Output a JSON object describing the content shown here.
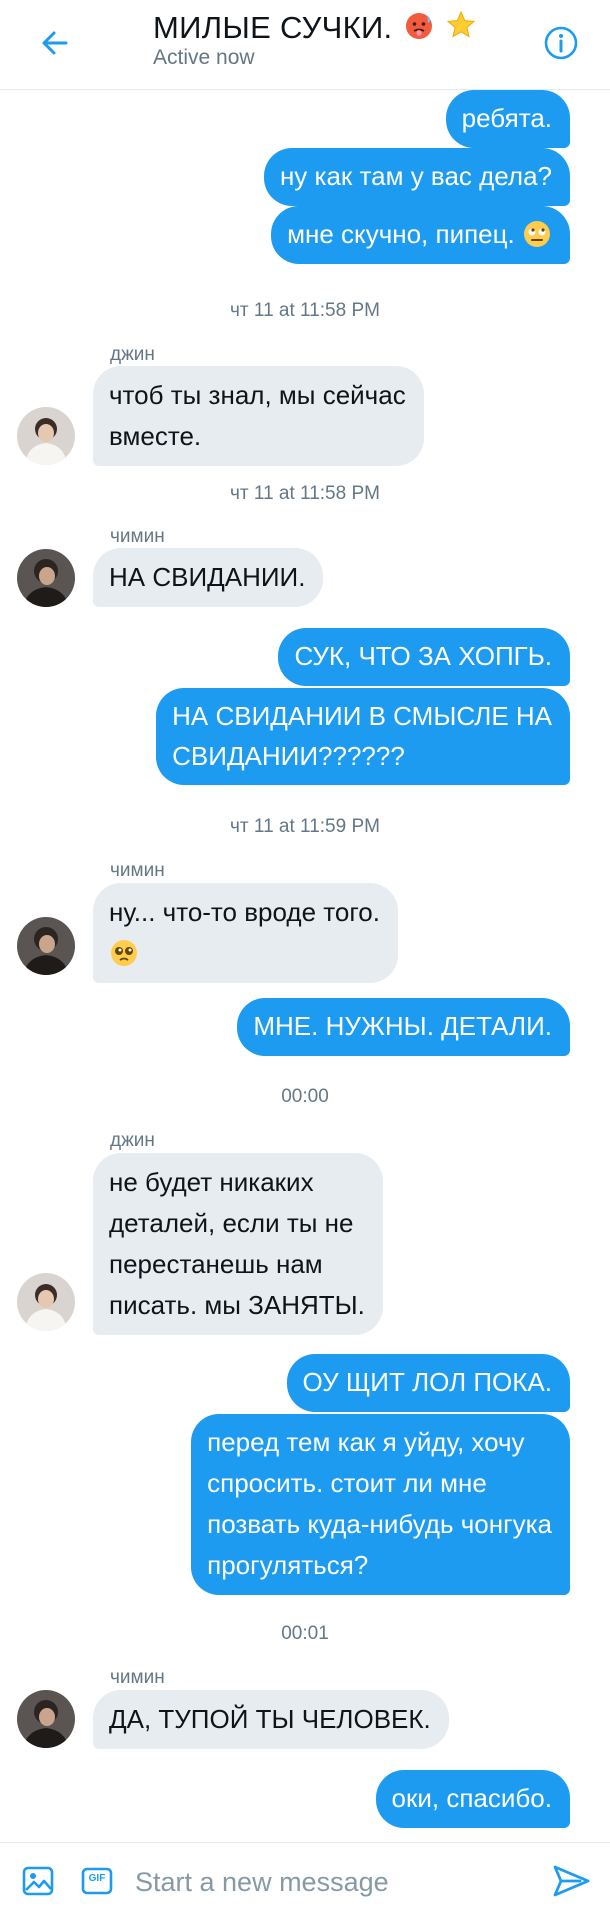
{
  "header": {
    "title": "МИЛЫЕ СУЧКИ.",
    "title_emojis": [
      "hot-face-emoji",
      "star-emoji"
    ],
    "status": "Active now",
    "back_icon": "arrow-left-icon",
    "info_icon": "info-icon"
  },
  "colors": {
    "accent": "#1d9bf0",
    "incoming_bubble": "#e7ecf0",
    "muted_text": "#657786"
  },
  "messages": {
    "m1": "ребята.",
    "m2": "ну как там у вас дела?",
    "m3": "мне скучно, пипец.",
    "m3_emoji": "face-with-rolling-eyes-emoji",
    "ts1": "чт 11 at 11:58 PM",
    "s1": "джин",
    "m4_l1": "чтоб ты знал, мы сейчас",
    "m4_l2": "вместе.",
    "ts2": "чт 11 at 11:58 PM",
    "s2": "чимин",
    "m5": "НА СВИДАНИИ.",
    "m6": "СУК, ЧТО ЗА ХОПГЬ.",
    "m7_l1": "НА СВИДАНИИ В СМЫСЛЕ НА",
    "m7_l2": "СВИДАНИИ??????",
    "ts3": "чт 11 at 11:59 PM",
    "s3": "чимин",
    "m8": "ну... что-то вроде того.",
    "m8_emoji": "pleading-face-emoji",
    "m9": "МНЕ. НУЖНЫ. ДЕТАЛИ.",
    "ts4": "00:00",
    "s4": "джин",
    "m10_l1": "не будет никаких",
    "m10_l2": "деталей, если ты не",
    "m10_l3": "перестанешь нам",
    "m10_l4": "писать. мы ЗАНЯТЫ.",
    "m11": "ОУ ЩИТ ЛОЛ ПОКА.",
    "m12_l1": "перед тем как я уйду, хочу",
    "m12_l2": "спросить. стоит ли мне",
    "m12_l3": "позвать куда-нибудь чонгука",
    "m12_l4": "прогуляться?",
    "ts5": "00:01",
    "s5": "чимин",
    "m13": "ДА, ТУПОЙ ТЫ ЧЕЛОВЕК.",
    "m14": "оки, спасибо."
  },
  "avatars": {
    "jin": "avatar-jin",
    "jimin": "avatar-jimin"
  },
  "composer": {
    "placeholder": "Start a new message",
    "gif_label": "GIF",
    "media_icon": "image-icon",
    "send_icon": "send-icon"
  }
}
